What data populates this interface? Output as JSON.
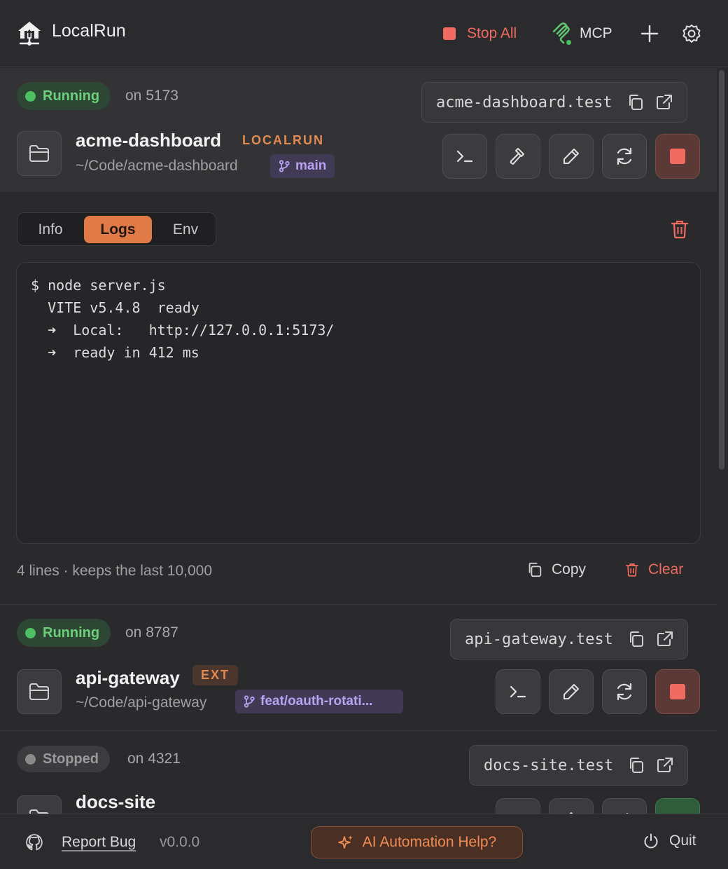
{
  "app": {
    "title": "LocalRun"
  },
  "header": {
    "stop_all": "Stop All",
    "mcp": "MCP"
  },
  "services": [
    {
      "status": "Running",
      "port": "on 5173",
      "domain": "acme-dashboard.test",
      "name": "acme-dashboard",
      "tag": "LOCALRUN",
      "path": "~/Code/acme-dashboard",
      "branch": "main"
    },
    {
      "status": "Running",
      "port": "on 8787",
      "domain": "api-gateway.test",
      "name": "api-gateway",
      "tag": "EXT",
      "path": "~/Code/api-gateway",
      "branch": "feat/oauth-rotati..."
    },
    {
      "status": "Stopped",
      "port": "on 4321",
      "domain": "docs-site.test",
      "name": "docs-site"
    }
  ],
  "tabs": [
    "Info",
    "Logs",
    "Env"
  ],
  "active_tab": "Logs",
  "logs": {
    "lines": [
      "$ node server.js",
      "  VITE v5.4.8  ready",
      "  ➜  Local:   http://127.0.0.1:5173/",
      "  ➜  ready in 412 ms"
    ],
    "summary": "4 lines · keeps the last 10,000",
    "copy": "Copy",
    "clear": "Clear"
  },
  "footer": {
    "report_bug": "Report Bug",
    "version": "v0.0.0",
    "ai_help": "AI Automation Help?",
    "quit": "Quit"
  },
  "colors": {
    "accent": "#e07a46",
    "running": "#4cc062",
    "danger": "#ef6b5f",
    "branch": "#b9a2f2"
  }
}
